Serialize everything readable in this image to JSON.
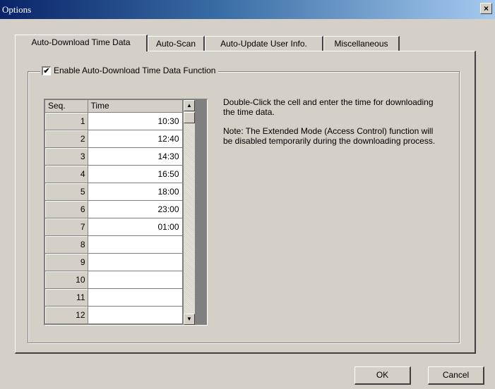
{
  "window": {
    "title": "Options",
    "close_label": "×"
  },
  "tabs": [
    {
      "label": "Auto-Download Time Data"
    },
    {
      "label": "Auto-Scan"
    },
    {
      "label": "Auto-Update User Info."
    },
    {
      "label": "Miscellaneous"
    }
  ],
  "group": {
    "checkbox_label": "Enable Auto-Download Time Data Function",
    "checked": true,
    "check_mark": "✔"
  },
  "grid": {
    "headers": [
      "Seq.",
      "Time"
    ],
    "rows": [
      {
        "seq": "1",
        "time": "10:30"
      },
      {
        "seq": "2",
        "time": "12:40"
      },
      {
        "seq": "3",
        "time": "14:30"
      },
      {
        "seq": "4",
        "time": "16:50"
      },
      {
        "seq": "5",
        "time": "18:00"
      },
      {
        "seq": "6",
        "time": "23:00"
      },
      {
        "seq": "7",
        "time": "01:00"
      },
      {
        "seq": "8",
        "time": ""
      },
      {
        "seq": "9",
        "time": ""
      },
      {
        "seq": "10",
        "time": ""
      },
      {
        "seq": "11",
        "time": ""
      },
      {
        "seq": "12",
        "time": ""
      }
    ],
    "scroll_up_icon": "▲",
    "scroll_down_icon": "▼"
  },
  "help": {
    "instruction": "Double-Click the cell and enter the time for downloading the time data.",
    "note": "Note: The Extended Mode (Access Control) function will be disabled temporarily during the downloading process."
  },
  "buttons": {
    "ok": "OK",
    "cancel": "Cancel"
  }
}
